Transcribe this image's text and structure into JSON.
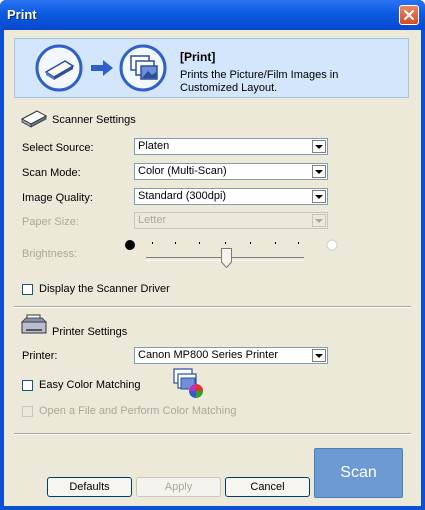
{
  "window": {
    "title": "Print"
  },
  "banner": {
    "title": "[Print]",
    "description": "Prints the Picture/Film Images in Customized Layout."
  },
  "scanner": {
    "heading": "Scanner Settings",
    "source": {
      "label": "Select Source:",
      "value": "Platen"
    },
    "mode": {
      "label": "Scan Mode:",
      "value": "Color (Multi-Scan)"
    },
    "quality": {
      "label": "Image Quality:",
      "value": "Standard (300dpi)"
    },
    "paper": {
      "label": "Paper Size:",
      "value": "Letter"
    },
    "brightness": {
      "label": "Brightness:",
      "level": 0.5
    },
    "driver_label": "Display the Scanner Driver"
  },
  "printer": {
    "heading": "Printer Settings",
    "label": "Printer:",
    "value": "Canon MP800 Series Printer",
    "easy_color_label": "Easy Color Matching",
    "open_file_label": "Open a File and Perform Color Matching"
  },
  "buttons": {
    "defaults": "Defaults",
    "apply": "Apply",
    "cancel": "Cancel",
    "scan": "Scan"
  },
  "colors": {
    "title_bar": "#0d5be0",
    "scan_button": "#6b9bd2",
    "banner_bg": "#d3e6fb"
  }
}
